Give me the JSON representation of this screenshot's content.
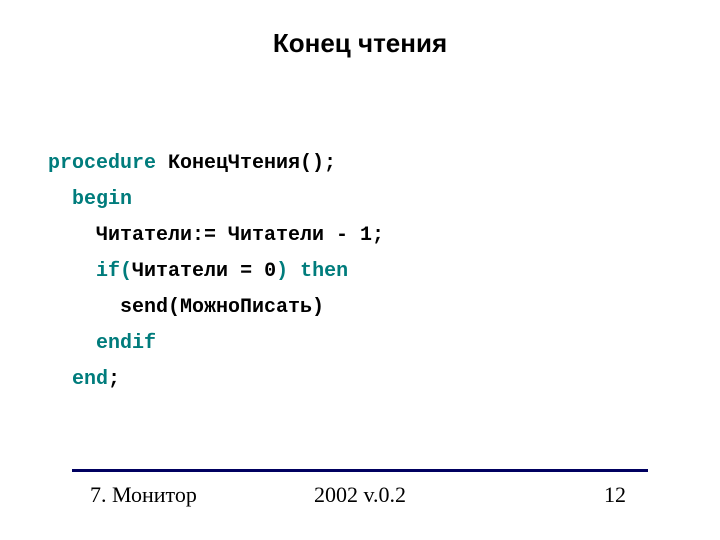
{
  "title": "Конец чтения",
  "code": {
    "l1_kw": "procedure",
    "l1_rest": " КонецЧтения();",
    "l2_kw": "begin",
    "l3": "Читатели:= Читатели - 1;",
    "l4_kw1": "if",
    "l4_open": "(",
    "l4_expr": "Читатели = 0",
    "l4_close": ")",
    "l4_kw2": " then",
    "l5": "send(МожноПисать)",
    "l6_kw": "endif",
    "l7_kw": "end",
    "l7_semi": ";"
  },
  "footer": {
    "left": "7. Монитор",
    "center": "2002 v.0.2",
    "right": "12"
  }
}
